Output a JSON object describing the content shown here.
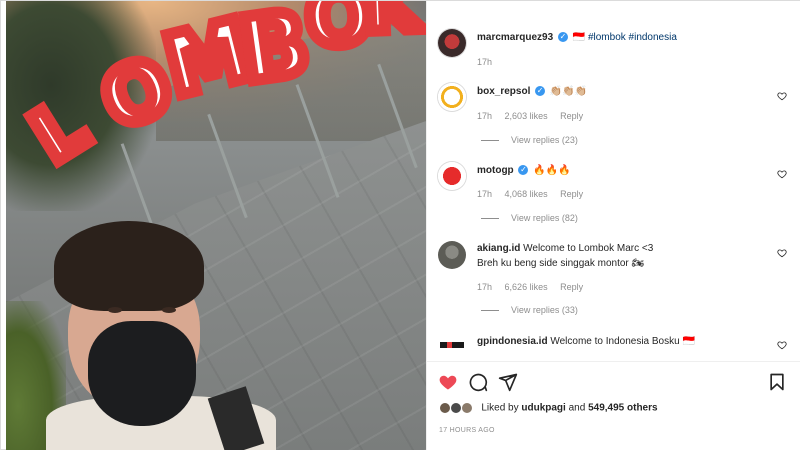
{
  "photo": {
    "sign_letters": [
      "L",
      "O",
      "M",
      "B",
      "O",
      "K"
    ]
  },
  "post": {
    "author": "marcmarquez93",
    "caption_emoji": "🇮🇩",
    "hashtags": "#lombok #indonesia",
    "time": "17h"
  },
  "comments": [
    {
      "username": "box_repsol",
      "verified": true,
      "text": "👏🏼👏🏼👏🏼",
      "time": "17h",
      "likes": "2,603 likes",
      "reply": "Reply",
      "view_replies": "View replies (23)"
    },
    {
      "username": "motogp",
      "verified": true,
      "text": "🔥🔥🔥",
      "time": "17h",
      "likes": "4,068 likes",
      "reply": "Reply",
      "view_replies": "View replies (82)"
    },
    {
      "username": "akiang.id",
      "verified": false,
      "text": "Welcome to Lombok Marc <3",
      "text2": "Breh ku beng side singgak montor 🏍",
      "time": "17h",
      "likes": "6,626 likes",
      "reply": "Reply",
      "view_replies": "View replies (33)"
    },
    {
      "username": "gpindonesia.id",
      "verified": false,
      "text": "Welcome to Indonesia Bosku 🇮🇩"
    }
  ],
  "actions": {
    "liked_by_prefix": "Liked by",
    "liked_by_user": "udukpagi",
    "liked_by_and": "and",
    "others": "549,495 others",
    "time_ago": "17 HOURS AGO"
  },
  "colors": {
    "heart_red": "#ed4956",
    "link_blue": "#00376b",
    "verified_blue": "#3897f0",
    "muted": "#8e8e8e",
    "sign_red": "#e13b3b"
  },
  "icons": {
    "like": "heart-filled-icon",
    "comment": "comment-bubble-icon",
    "share": "paper-plane-icon",
    "save": "bookmark-icon",
    "comment_like": "heart-outline-icon",
    "verified": "verified-badge-icon"
  }
}
